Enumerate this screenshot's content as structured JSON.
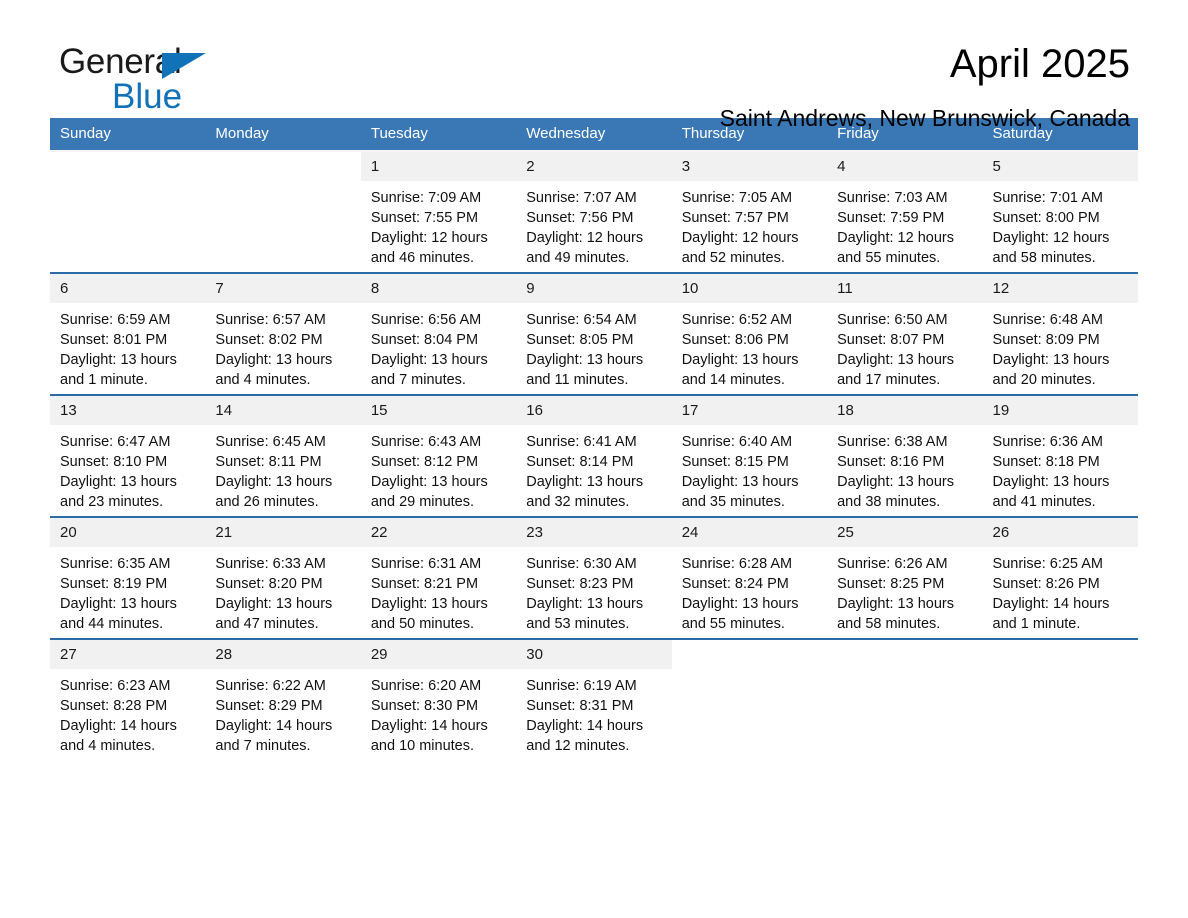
{
  "brand": {
    "name_part1": "General",
    "name_part2": "Blue",
    "accent_color": "#1272b8"
  },
  "header": {
    "title": "April 2025",
    "subtitle": "Saint Andrews, New Brunswick, Canada",
    "header_bg_color": "#3a78b5",
    "row_divider_color": "#2b6ca8",
    "daynum_bg_color": "#f1f1f1"
  },
  "weekday_headers": [
    "Sunday",
    "Monday",
    "Tuesday",
    "Wednesday",
    "Thursday",
    "Friday",
    "Saturday"
  ],
  "weeks": [
    [
      {
        "day": "",
        "sunrise": "",
        "sunset": "",
        "daylight1": "",
        "daylight2": ""
      },
      {
        "day": "",
        "sunrise": "",
        "sunset": "",
        "daylight1": "",
        "daylight2": ""
      },
      {
        "day": "1",
        "sunrise": "Sunrise: 7:09 AM",
        "sunset": "Sunset: 7:55 PM",
        "daylight1": "Daylight: 12 hours",
        "daylight2": "and 46 minutes."
      },
      {
        "day": "2",
        "sunrise": "Sunrise: 7:07 AM",
        "sunset": "Sunset: 7:56 PM",
        "daylight1": "Daylight: 12 hours",
        "daylight2": "and 49 minutes."
      },
      {
        "day": "3",
        "sunrise": "Sunrise: 7:05 AM",
        "sunset": "Sunset: 7:57 PM",
        "daylight1": "Daylight: 12 hours",
        "daylight2": "and 52 minutes."
      },
      {
        "day": "4",
        "sunrise": "Sunrise: 7:03 AM",
        "sunset": "Sunset: 7:59 PM",
        "daylight1": "Daylight: 12 hours",
        "daylight2": "and 55 minutes."
      },
      {
        "day": "5",
        "sunrise": "Sunrise: 7:01 AM",
        "sunset": "Sunset: 8:00 PM",
        "daylight1": "Daylight: 12 hours",
        "daylight2": "and 58 minutes."
      }
    ],
    [
      {
        "day": "6",
        "sunrise": "Sunrise: 6:59 AM",
        "sunset": "Sunset: 8:01 PM",
        "daylight1": "Daylight: 13 hours",
        "daylight2": "and 1 minute."
      },
      {
        "day": "7",
        "sunrise": "Sunrise: 6:57 AM",
        "sunset": "Sunset: 8:02 PM",
        "daylight1": "Daylight: 13 hours",
        "daylight2": "and 4 minutes."
      },
      {
        "day": "8",
        "sunrise": "Sunrise: 6:56 AM",
        "sunset": "Sunset: 8:04 PM",
        "daylight1": "Daylight: 13 hours",
        "daylight2": "and 7 minutes."
      },
      {
        "day": "9",
        "sunrise": "Sunrise: 6:54 AM",
        "sunset": "Sunset: 8:05 PM",
        "daylight1": "Daylight: 13 hours",
        "daylight2": "and 11 minutes."
      },
      {
        "day": "10",
        "sunrise": "Sunrise: 6:52 AM",
        "sunset": "Sunset: 8:06 PM",
        "daylight1": "Daylight: 13 hours",
        "daylight2": "and 14 minutes."
      },
      {
        "day": "11",
        "sunrise": "Sunrise: 6:50 AM",
        "sunset": "Sunset: 8:07 PM",
        "daylight1": "Daylight: 13 hours",
        "daylight2": "and 17 minutes."
      },
      {
        "day": "12",
        "sunrise": "Sunrise: 6:48 AM",
        "sunset": "Sunset: 8:09 PM",
        "daylight1": "Daylight: 13 hours",
        "daylight2": "and 20 minutes."
      }
    ],
    [
      {
        "day": "13",
        "sunrise": "Sunrise: 6:47 AM",
        "sunset": "Sunset: 8:10 PM",
        "daylight1": "Daylight: 13 hours",
        "daylight2": "and 23 minutes."
      },
      {
        "day": "14",
        "sunrise": "Sunrise: 6:45 AM",
        "sunset": "Sunset: 8:11 PM",
        "daylight1": "Daylight: 13 hours",
        "daylight2": "and 26 minutes."
      },
      {
        "day": "15",
        "sunrise": "Sunrise: 6:43 AM",
        "sunset": "Sunset: 8:12 PM",
        "daylight1": "Daylight: 13 hours",
        "daylight2": "and 29 minutes."
      },
      {
        "day": "16",
        "sunrise": "Sunrise: 6:41 AM",
        "sunset": "Sunset: 8:14 PM",
        "daylight1": "Daylight: 13 hours",
        "daylight2": "and 32 minutes."
      },
      {
        "day": "17",
        "sunrise": "Sunrise: 6:40 AM",
        "sunset": "Sunset: 8:15 PM",
        "daylight1": "Daylight: 13 hours",
        "daylight2": "and 35 minutes."
      },
      {
        "day": "18",
        "sunrise": "Sunrise: 6:38 AM",
        "sunset": "Sunset: 8:16 PM",
        "daylight1": "Daylight: 13 hours",
        "daylight2": "and 38 minutes."
      },
      {
        "day": "19",
        "sunrise": "Sunrise: 6:36 AM",
        "sunset": "Sunset: 8:18 PM",
        "daylight1": "Daylight: 13 hours",
        "daylight2": "and 41 minutes."
      }
    ],
    [
      {
        "day": "20",
        "sunrise": "Sunrise: 6:35 AM",
        "sunset": "Sunset: 8:19 PM",
        "daylight1": "Daylight: 13 hours",
        "daylight2": "and 44 minutes."
      },
      {
        "day": "21",
        "sunrise": "Sunrise: 6:33 AM",
        "sunset": "Sunset: 8:20 PM",
        "daylight1": "Daylight: 13 hours",
        "daylight2": "and 47 minutes."
      },
      {
        "day": "22",
        "sunrise": "Sunrise: 6:31 AM",
        "sunset": "Sunset: 8:21 PM",
        "daylight1": "Daylight: 13 hours",
        "daylight2": "and 50 minutes."
      },
      {
        "day": "23",
        "sunrise": "Sunrise: 6:30 AM",
        "sunset": "Sunset: 8:23 PM",
        "daylight1": "Daylight: 13 hours",
        "daylight2": "and 53 minutes."
      },
      {
        "day": "24",
        "sunrise": "Sunrise: 6:28 AM",
        "sunset": "Sunset: 8:24 PM",
        "daylight1": "Daylight: 13 hours",
        "daylight2": "and 55 minutes."
      },
      {
        "day": "25",
        "sunrise": "Sunrise: 6:26 AM",
        "sunset": "Sunset: 8:25 PM",
        "daylight1": "Daylight: 13 hours",
        "daylight2": "and 58 minutes."
      },
      {
        "day": "26",
        "sunrise": "Sunrise: 6:25 AM",
        "sunset": "Sunset: 8:26 PM",
        "daylight1": "Daylight: 14 hours",
        "daylight2": "and 1 minute."
      }
    ],
    [
      {
        "day": "27",
        "sunrise": "Sunrise: 6:23 AM",
        "sunset": "Sunset: 8:28 PM",
        "daylight1": "Daylight: 14 hours",
        "daylight2": "and 4 minutes."
      },
      {
        "day": "28",
        "sunrise": "Sunrise: 6:22 AM",
        "sunset": "Sunset: 8:29 PM",
        "daylight1": "Daylight: 14 hours",
        "daylight2": "and 7 minutes."
      },
      {
        "day": "29",
        "sunrise": "Sunrise: 6:20 AM",
        "sunset": "Sunset: 8:30 PM",
        "daylight1": "Daylight: 14 hours",
        "daylight2": "and 10 minutes."
      },
      {
        "day": "30",
        "sunrise": "Sunrise: 6:19 AM",
        "sunset": "Sunset: 8:31 PM",
        "daylight1": "Daylight: 14 hours",
        "daylight2": "and 12 minutes."
      },
      {
        "day": "",
        "sunrise": "",
        "sunset": "",
        "daylight1": "",
        "daylight2": ""
      },
      {
        "day": "",
        "sunrise": "",
        "sunset": "",
        "daylight1": "",
        "daylight2": ""
      },
      {
        "day": "",
        "sunrise": "",
        "sunset": "",
        "daylight1": "",
        "daylight2": ""
      }
    ]
  ]
}
